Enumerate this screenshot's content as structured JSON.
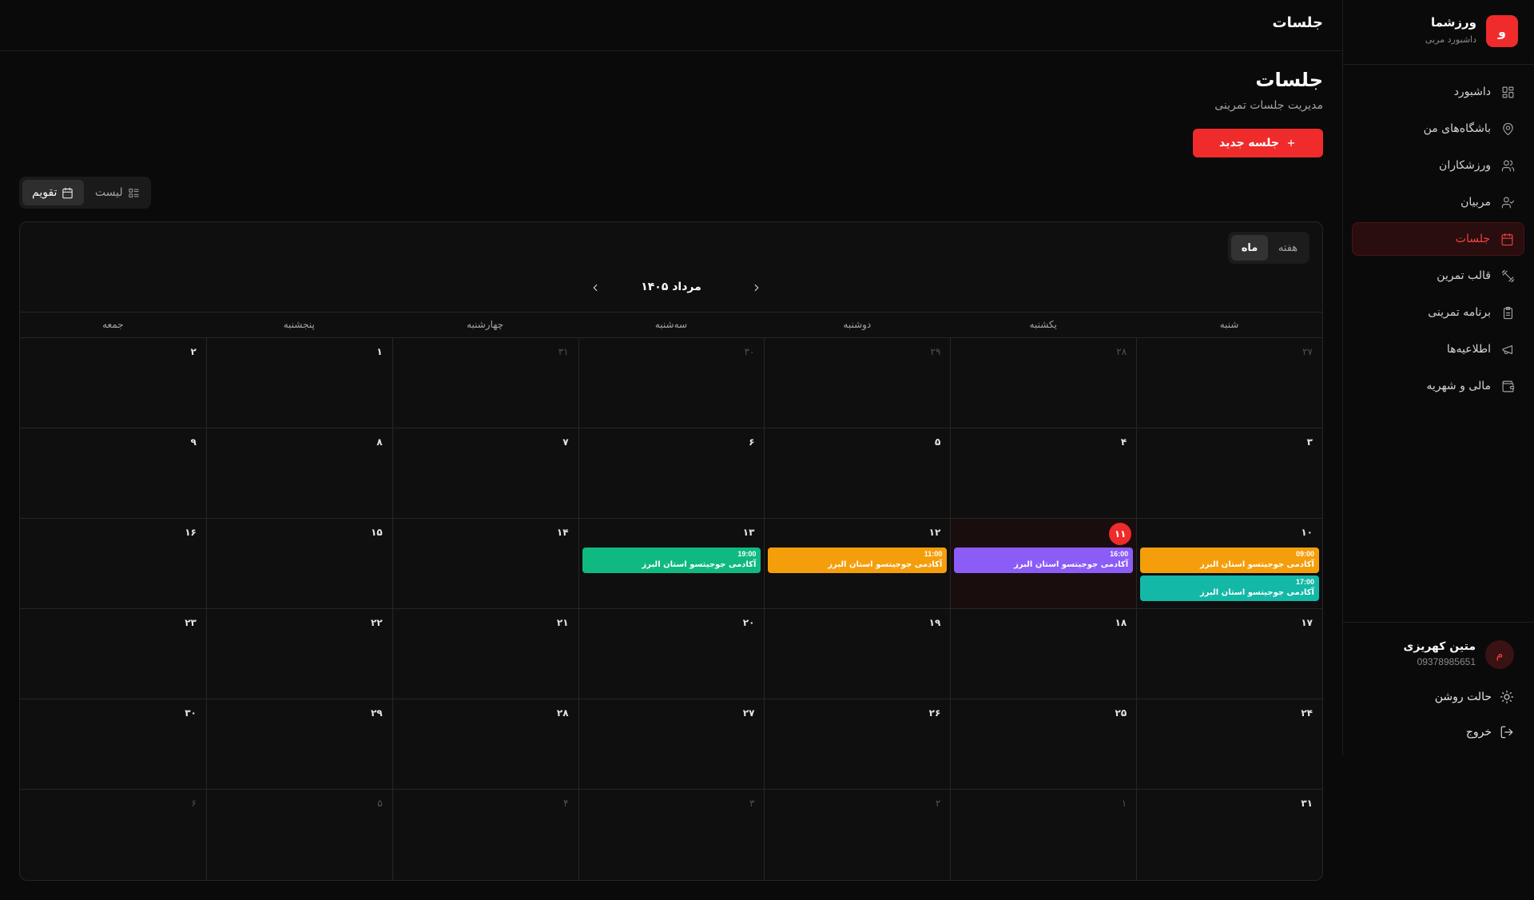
{
  "sidebar": {
    "brand": {
      "logo_letter": "و",
      "name": "ورزشما",
      "subtitle": "داشبورد مربی"
    },
    "items": [
      {
        "label": "داشبورد",
        "icon": "dashboard-icon",
        "active": false
      },
      {
        "label": "باشگاه‌های من",
        "icon": "map-pin-icon",
        "active": false
      },
      {
        "label": "ورزشکاران",
        "icon": "users-icon",
        "active": false
      },
      {
        "label": "مربیان",
        "icon": "user-check-icon",
        "active": false
      },
      {
        "label": "جلسات",
        "icon": "calendar-icon",
        "active": true
      },
      {
        "label": "قالب تمرین",
        "icon": "dumbbell-icon",
        "active": false
      },
      {
        "label": "برنامه تمرینی",
        "icon": "clipboard-icon",
        "active": false
      },
      {
        "label": "اطلاعیه‌ها",
        "icon": "megaphone-icon",
        "active": false
      },
      {
        "label": "مالی و شهریه",
        "icon": "wallet-icon",
        "active": false
      }
    ],
    "user": {
      "avatar_letter": "م",
      "name": "متین کهریزی",
      "phone": "09378985651"
    },
    "theme_toggle_label": "حالت روشن",
    "logout_label": "خروج"
  },
  "topbar": {
    "title": "جلسات"
  },
  "page": {
    "title": "جلسات",
    "subtitle": "مدیریت جلسات تمرینی",
    "new_button_label": "جلسه جدید"
  },
  "view_toggle": {
    "calendar_label": "تقویم",
    "list_label": "لیست",
    "selected": "calendar"
  },
  "calendar": {
    "mode_week_label": "هفته",
    "mode_month_label": "ماه",
    "selected_mode": "month",
    "month_label": "مرداد ۱۴۰۵",
    "weekdays": [
      "شنبه",
      "یکشنبه",
      "دوشنبه",
      "سه‌شنبه",
      "چهارشنبه",
      "پنجشنبه",
      "جمعه"
    ],
    "cells": [
      {
        "day": "۲۷",
        "other": true
      },
      {
        "day": "۲۸",
        "other": true
      },
      {
        "day": "۲۹",
        "other": true
      },
      {
        "day": "۳۰",
        "other": true
      },
      {
        "day": "۳۱",
        "other": true
      },
      {
        "day": "۱"
      },
      {
        "day": "۲"
      },
      {
        "day": "۳"
      },
      {
        "day": "۴"
      },
      {
        "day": "۵"
      },
      {
        "day": "۶"
      },
      {
        "day": "۷"
      },
      {
        "day": "۸"
      },
      {
        "day": "۹"
      },
      {
        "day": "۱۰",
        "events": [
          {
            "time": "09:00",
            "title": "آکادمی جوجیتسو استان البرز",
            "color": "#f59e0b"
          },
          {
            "time": "17:00",
            "title": "آکادمی جوجیتسو استان البرز",
            "color": "#14b8a6"
          }
        ]
      },
      {
        "day": "۱۱",
        "today": true,
        "events": [
          {
            "time": "16:00",
            "title": "آکادمی جوجیتسو استان البرز",
            "color": "#8b5cf6"
          }
        ]
      },
      {
        "day": "۱۲",
        "events": [
          {
            "time": "11:00",
            "title": "آکادمی جوجیتسو استان البرز",
            "color": "#f59e0b"
          }
        ]
      },
      {
        "day": "۱۳",
        "events": [
          {
            "time": "19:00",
            "title": "آکادمی جوجیتسو استان البرز",
            "color": "#10b981"
          }
        ]
      },
      {
        "day": "۱۴"
      },
      {
        "day": "۱۵"
      },
      {
        "day": "۱۶"
      },
      {
        "day": "۱۷"
      },
      {
        "day": "۱۸"
      },
      {
        "day": "۱۹"
      },
      {
        "day": "۲۰"
      },
      {
        "day": "۲۱"
      },
      {
        "day": "۲۲"
      },
      {
        "day": "۲۳"
      },
      {
        "day": "۲۴"
      },
      {
        "day": "۲۵"
      },
      {
        "day": "۲۶"
      },
      {
        "day": "۲۷"
      },
      {
        "day": "۲۸"
      },
      {
        "day": "۲۹"
      },
      {
        "day": "۳۰"
      },
      {
        "day": "۳۱"
      },
      {
        "day": "۱",
        "other": true
      },
      {
        "day": "۲",
        "other": true
      },
      {
        "day": "۳",
        "other": true
      },
      {
        "day": "۴",
        "other": true
      },
      {
        "day": "۵",
        "other": true
      },
      {
        "day": "۶",
        "other": true
      }
    ]
  },
  "colors": {
    "accent": "#ef2b2b",
    "background": "#0a0a0a",
    "card": "#0f0f0f",
    "border": "#262626"
  }
}
